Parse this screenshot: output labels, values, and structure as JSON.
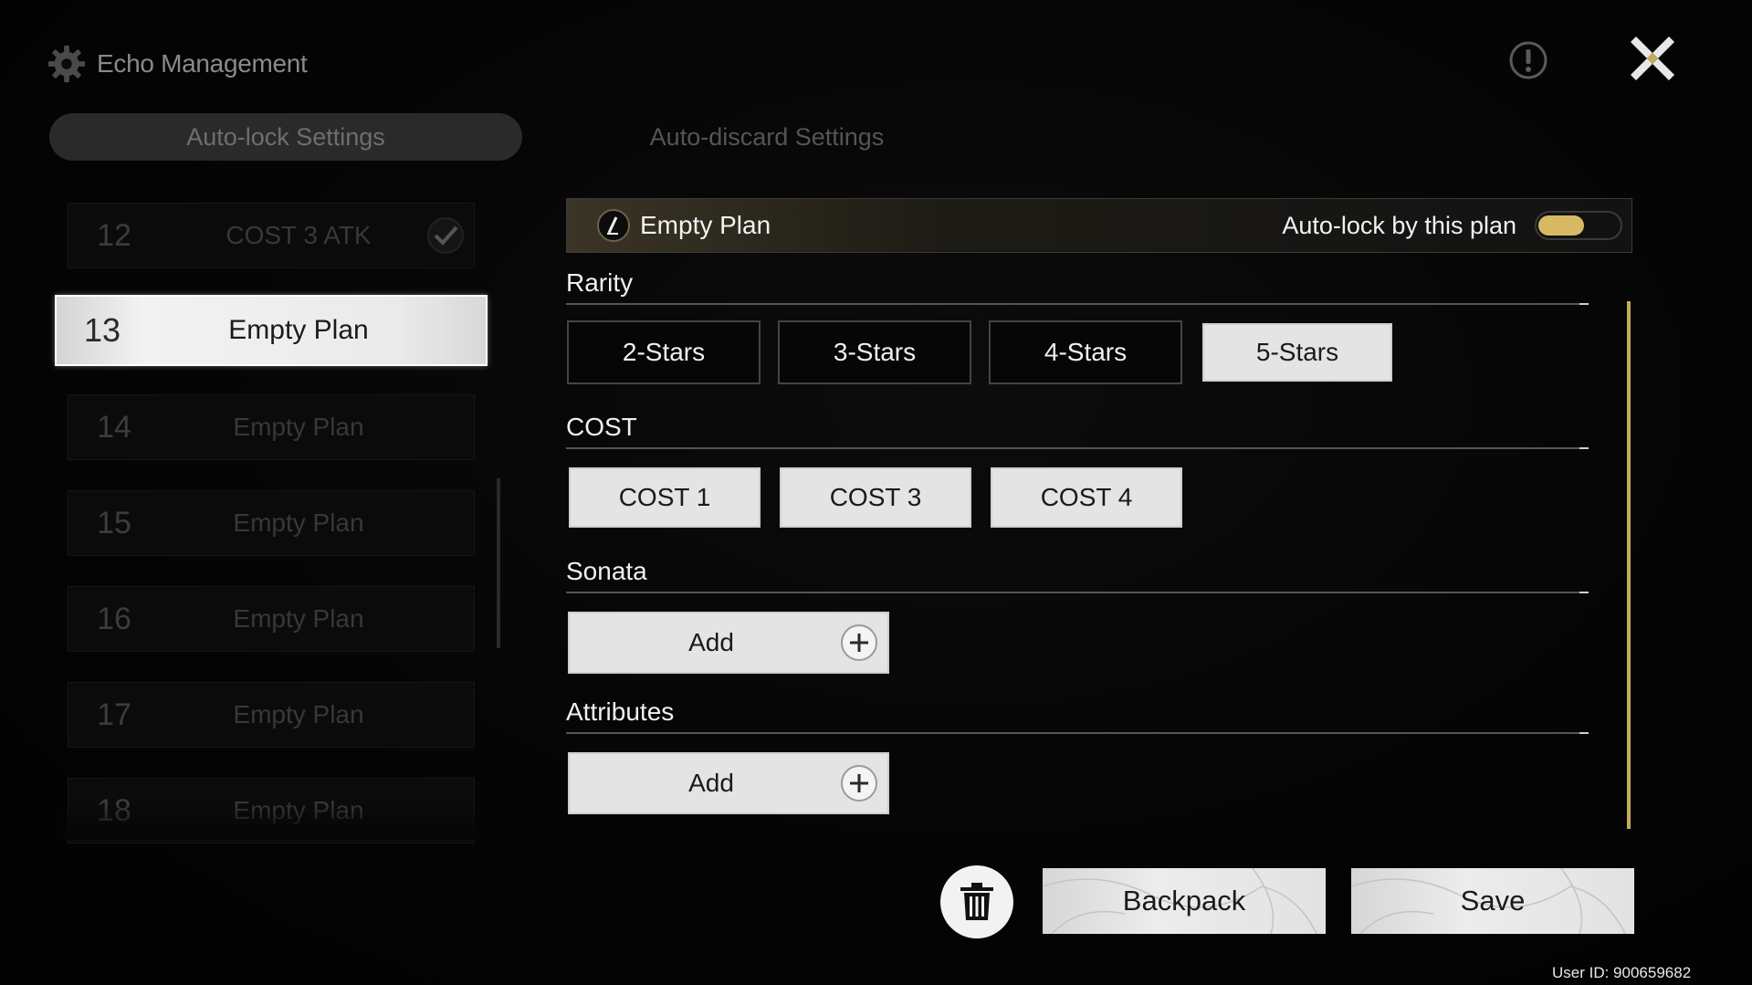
{
  "header": {
    "title": "Echo Management",
    "settings_icon": "gear-icon",
    "alert_icon": "exclamation-circle-icon",
    "close_icon": "close-x-icon"
  },
  "tabs": [
    {
      "label": "Auto-lock Settings",
      "active": true
    },
    {
      "label": "Auto-discard Settings",
      "active": false
    }
  ],
  "plans": [
    {
      "number": "12",
      "name": "COST 3 ATK",
      "checked": true
    },
    {
      "number": "13",
      "name": "Empty Plan",
      "selected": true
    },
    {
      "number": "14",
      "name": "Empty Plan"
    },
    {
      "number": "15",
      "name": "Empty Plan"
    },
    {
      "number": "16",
      "name": "Empty Plan"
    },
    {
      "number": "17",
      "name": "Empty Plan"
    },
    {
      "number": "18",
      "name": "Empty Plan"
    }
  ],
  "plan_editor": {
    "name": "Empty Plan",
    "autolock_label": "Auto-lock by this plan",
    "autolock_on": true,
    "accent_color": "#d6b962"
  },
  "rarity": {
    "title": "Rarity",
    "options": [
      {
        "label": "2-Stars",
        "selected": false
      },
      {
        "label": "3-Stars",
        "selected": false
      },
      {
        "label": "4-Stars",
        "selected": false
      },
      {
        "label": "5-Stars",
        "selected": true
      }
    ]
  },
  "cost": {
    "title": "COST",
    "options": [
      {
        "label": "COST 1",
        "selected": true
      },
      {
        "label": "COST 3",
        "selected": true
      },
      {
        "label": "COST 4",
        "selected": true
      }
    ]
  },
  "sonata": {
    "title": "Sonata",
    "add_label": "Add"
  },
  "attributes": {
    "title": "Attributes",
    "add_label": "Add"
  },
  "actions": {
    "delete_icon": "trash-icon",
    "backpack_label": "Backpack",
    "save_label": "Save"
  },
  "footer": {
    "user_id": "User ID: 900659682"
  }
}
